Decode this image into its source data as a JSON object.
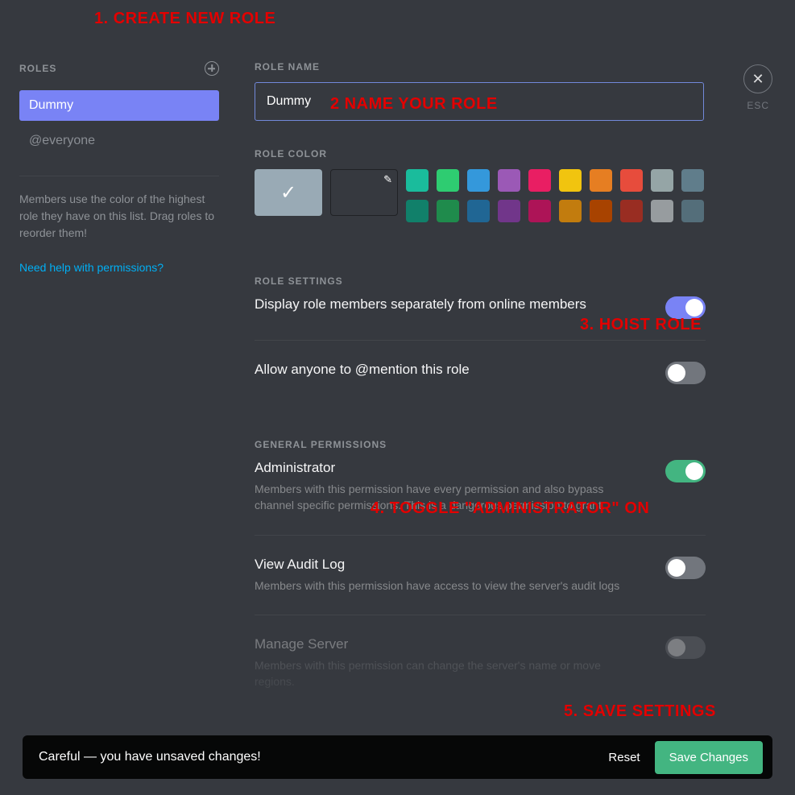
{
  "annotations": {
    "a1": "1. CREATE NEW ROLE",
    "a2": "2 NAME YOUR ROLE",
    "a3": "3. HOIST ROLE",
    "a4": "4. TOGGLE \"ADMINISTRATOR\" ON",
    "a5": "5.  SAVE SETTINGS"
  },
  "sidebar": {
    "title": "ROLES",
    "items": [
      {
        "name": "Dummy",
        "selected": true
      },
      {
        "name": "@everyone",
        "selected": false
      }
    ],
    "note": "Members use the color of the highest role they have on this list. Drag roles to reorder them!",
    "help": "Need help with permissions?"
  },
  "close": {
    "esc": "ESC"
  },
  "role_name": {
    "label": "ROLE NAME",
    "value": "Dummy"
  },
  "role_color": {
    "label": "ROLE COLOR",
    "selected": "#99aab5",
    "custom": "#36393f",
    "row1": [
      "#1abc9c",
      "#2ecc71",
      "#3498db",
      "#9b59b6",
      "#e91e63",
      "#f1c40f",
      "#e67e22",
      "#e74c3c",
      "#95a5a6",
      "#607d8b"
    ],
    "row2": [
      "#11806a",
      "#1f8b4c",
      "#206694",
      "#71368a",
      "#ad1457",
      "#c27c0e",
      "#a84300",
      "#992d22",
      "#979c9f",
      "#546e7a"
    ]
  },
  "role_settings": {
    "label": "ROLE SETTINGS",
    "hoist": {
      "title": "Display role members separately from online members",
      "on": true
    },
    "mention": {
      "title": "Allow anyone to @mention this role",
      "on": false
    }
  },
  "permissions": {
    "label": "GENERAL PERMISSIONS",
    "admin": {
      "title": "Administrator",
      "desc": "Members with this permission have every permission and also bypass channel specific permissions. This is a dangerous permission to grant.",
      "on": true
    },
    "audit": {
      "title": "View Audit Log",
      "desc": "Members with this permission have access to view the server's audit logs",
      "on": false
    },
    "manage": {
      "title": "Manage Server",
      "desc": "Members with this permission can change the server's name or move regions.",
      "on": false
    }
  },
  "unsaved": {
    "text": "Careful — you have unsaved changes!",
    "reset": "Reset",
    "save": "Save Changes"
  }
}
